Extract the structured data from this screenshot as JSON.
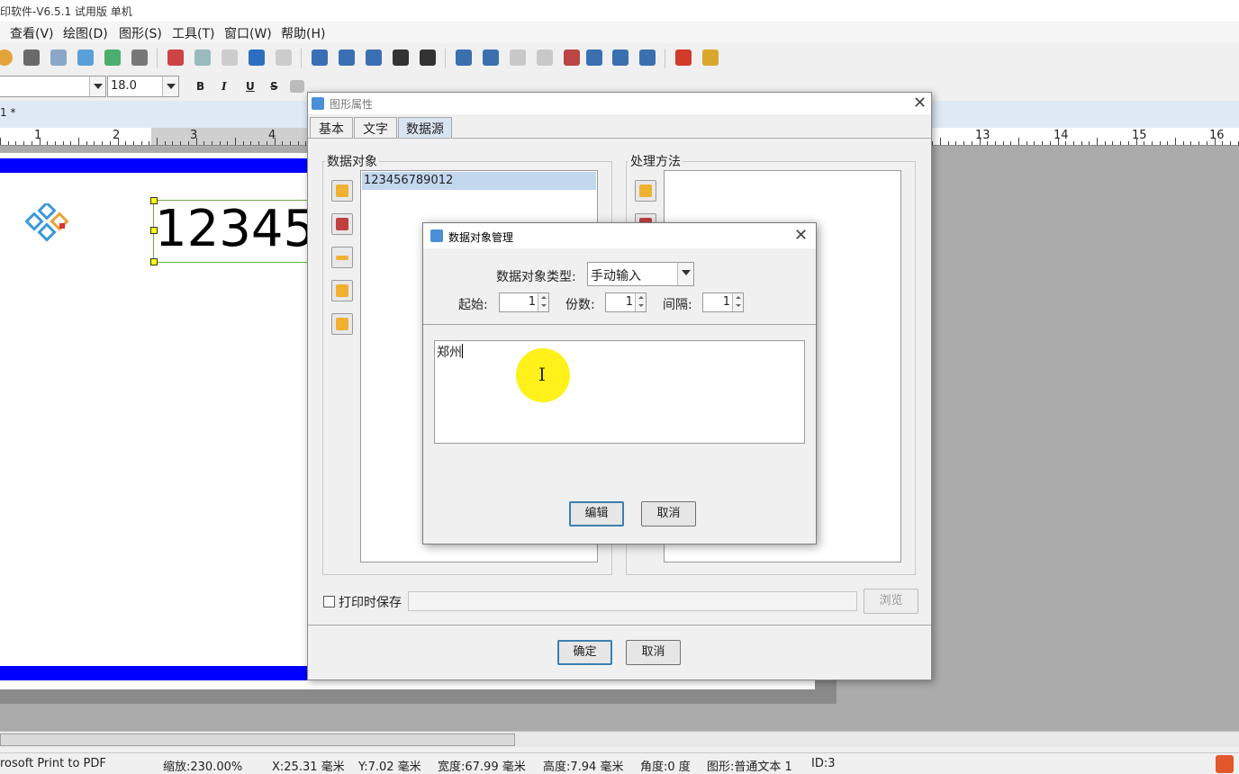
{
  "window": {
    "title": "印软件-V6.5.1 试用版 单机"
  },
  "menu": {
    "items": [
      "查看(V)",
      "绘图(D)",
      "图形(S)",
      "工具(T)",
      "窗口(W)",
      "帮助(H)"
    ]
  },
  "toolbar": {
    "font_size": "18.0",
    "format_buttons": [
      "B",
      "I",
      "U",
      "S"
    ]
  },
  "document": {
    "tab_label": "1 *"
  },
  "ruler": {
    "numbers": [
      "1",
      "2",
      "3",
      "4",
      "13",
      "14",
      "15",
      "16"
    ]
  },
  "label": {
    "text_preview": "123456789012"
  },
  "status": {
    "printer": "rosoft Print to PDF",
    "zoom": "缩放:230.00%",
    "x": "X:25.31 毫米",
    "y": "Y:7.02 毫米",
    "width": "宽度:67.99 毫米",
    "height": "高度:7.94 毫米",
    "angle": "角度:0 度",
    "shape": "图形:普通文本 1",
    "id": "ID:3"
  },
  "prop_dialog": {
    "title": "图形属性",
    "tabs": [
      "基本",
      "文字",
      "数据源"
    ],
    "active_tab": "数据源",
    "data_objects_title": "数据对象",
    "data_objects": [
      "123456789012"
    ],
    "processing_title": "处理方法",
    "save_on_print": "打印时保存",
    "browse": "浏览",
    "ok": "确定",
    "cancel": "取消"
  },
  "dom_dialog": {
    "title": "数据对象管理",
    "type_label": "数据对象类型:",
    "type_value": "手动输入",
    "start_label": "起始:",
    "start_value": "1",
    "copies_label": "份数:",
    "copies_value": "1",
    "interval_label": "间隔:",
    "interval_value": "1",
    "content": "郑州",
    "edit": "编辑",
    "cancel": "取消"
  },
  "colors": {
    "label_bar": "#0000ff",
    "cursor_highlight": "#ffef00",
    "selected_tab": "#d9e4f1"
  }
}
